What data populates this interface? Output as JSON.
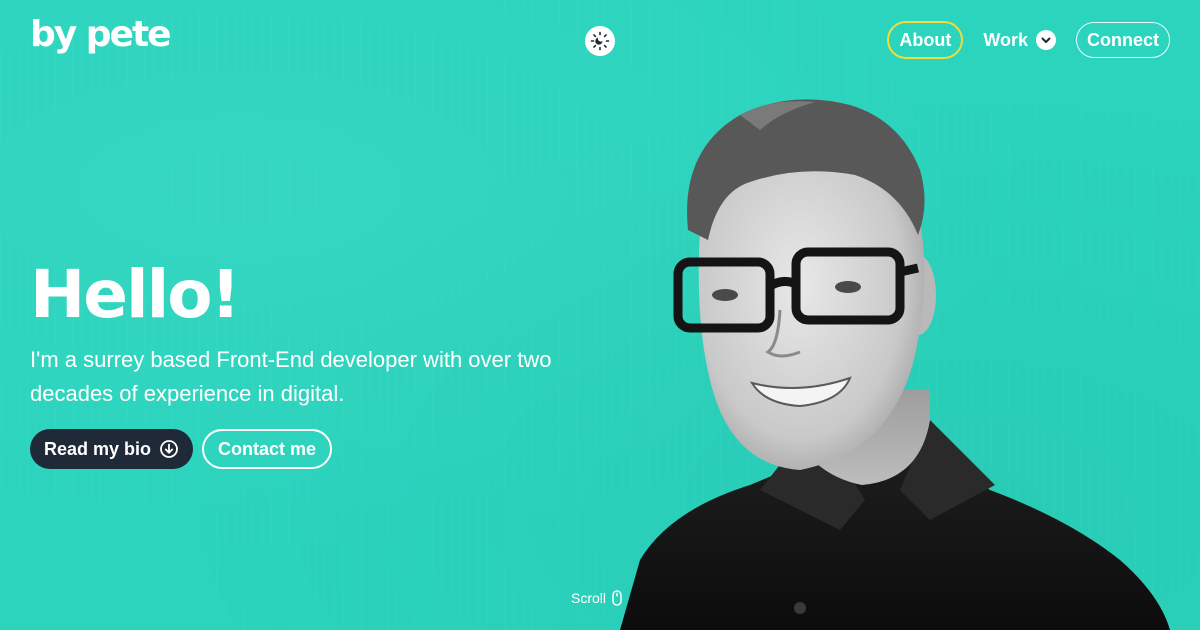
{
  "brand": {
    "logo_text": "by pete",
    "background_color": "#2ad4bd",
    "accent_color": "#f2dc3a",
    "dark_color": "#1f2937"
  },
  "header": {
    "theme_toggle_icon": "sun-moon-icon",
    "nav": {
      "about_label": "About",
      "work_label": "Work",
      "work_icon": "chevron-down-icon",
      "connect_label": "Connect"
    }
  },
  "hero": {
    "title": "Hello!",
    "subtitle": "I'm a surrey based Front-End developer with over two decades of experience in digital.",
    "primary_button": {
      "label": "Read my bio",
      "icon": "arrow-down-circle-icon"
    },
    "secondary_button": {
      "label": "Contact me"
    },
    "portrait_icon": "portrait-photo"
  },
  "scroll": {
    "label": "Scroll",
    "icon": "mouse-icon"
  }
}
